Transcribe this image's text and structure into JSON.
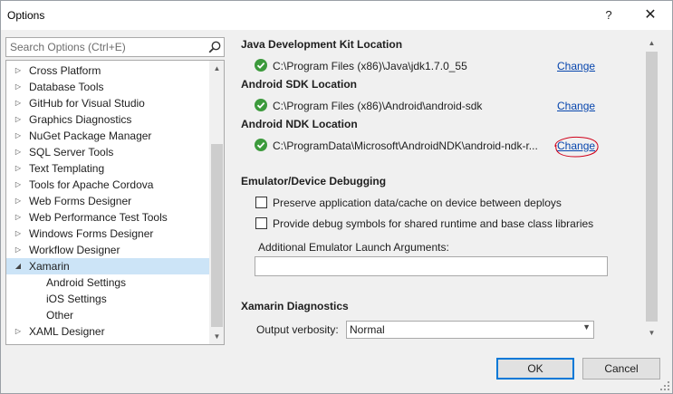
{
  "window": {
    "title": "Options",
    "help_glyph": "?",
    "close_glyph": "✕"
  },
  "search": {
    "placeholder": "Search Options (Ctrl+E)"
  },
  "tree": {
    "items": [
      {
        "label": "Cross Platform",
        "expanded": false
      },
      {
        "label": "Database Tools",
        "expanded": false
      },
      {
        "label": "GitHub for Visual Studio",
        "expanded": false
      },
      {
        "label": "Graphics Diagnostics",
        "expanded": false
      },
      {
        "label": "NuGet Package Manager",
        "expanded": false
      },
      {
        "label": "SQL Server Tools",
        "expanded": false
      },
      {
        "label": "Text Templating",
        "expanded": false
      },
      {
        "label": "Tools for Apache Cordova",
        "expanded": false
      },
      {
        "label": "Web Forms Designer",
        "expanded": false
      },
      {
        "label": "Web Performance Test Tools",
        "expanded": false
      },
      {
        "label": "Windows Forms Designer",
        "expanded": false
      },
      {
        "label": "Workflow Designer",
        "expanded": false
      },
      {
        "label": "Xamarin",
        "expanded": true,
        "selected": true
      },
      {
        "label": "Android Settings",
        "child": true
      },
      {
        "label": "iOS Settings",
        "child": true
      },
      {
        "label": "Other",
        "child": true
      },
      {
        "label": "XAML Designer",
        "expanded": false
      }
    ]
  },
  "sdk": {
    "jdk_title": "Java Development Kit Location",
    "jdk_path": "C:\\Program Files (x86)\\Java\\jdk1.7.0_55",
    "android_sdk_title": "Android SDK Location",
    "android_sdk_path": "C:\\Program Files (x86)\\Android\\android-sdk",
    "android_ndk_title": "Android NDK Location",
    "android_ndk_path": "C:\\ProgramData\\Microsoft\\AndroidNDK\\android-ndk-r...",
    "change_label": "Change"
  },
  "emulator": {
    "title": "Emulator/Device Debugging",
    "preserve_label": "Preserve application data/cache on device between deploys",
    "preserve_checked": false,
    "debug_symbols_label": "Provide debug symbols for shared runtime and base class libraries",
    "debug_symbols_checked": false,
    "args_label": "Additional Emulator Launch Arguments:",
    "args_value": ""
  },
  "diagnostics": {
    "title": "Xamarin Diagnostics",
    "verbosity_label": "Output verbosity:",
    "verbosity_value": "Normal"
  },
  "buttons": {
    "ok": "OK",
    "cancel": "Cancel"
  },
  "colors": {
    "accent": "#0078d7",
    "check_green": "#3c9a3c",
    "link": "#0645ad",
    "selection": "#cce4f7",
    "annotation_red": "#d0021b"
  }
}
